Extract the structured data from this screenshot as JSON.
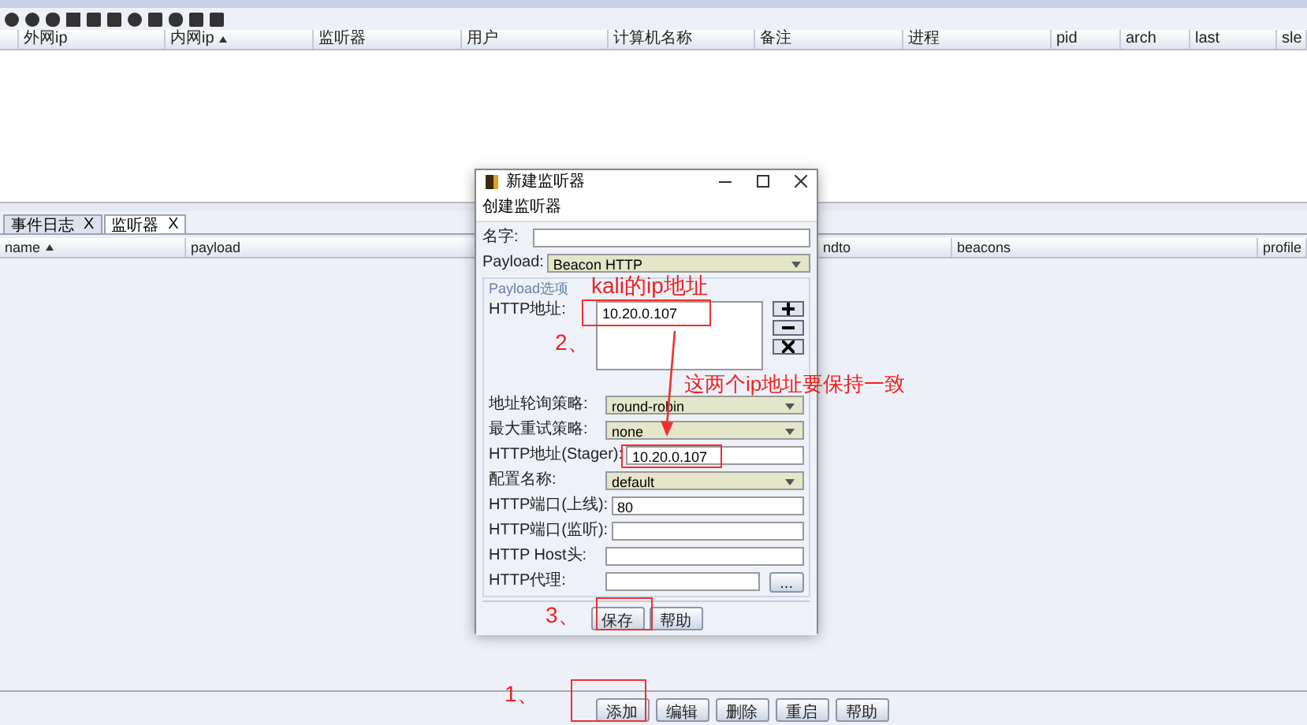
{
  "sessions_table": {
    "columns": [
      {
        "label": "外网ip"
      },
      {
        "label": "内网ip",
        "sorted": true
      },
      {
        "label": "监听器"
      },
      {
        "label": "用户"
      },
      {
        "label": "计算机名称"
      },
      {
        "label": "备注"
      },
      {
        "label": "进程"
      },
      {
        "label": "pid"
      },
      {
        "label": "arch"
      },
      {
        "label": "last"
      },
      {
        "label": "sle"
      }
    ]
  },
  "tabs": [
    {
      "label": "事件日志",
      "close": "X",
      "selected": false
    },
    {
      "label": "监听器",
      "close": "X",
      "selected": true
    }
  ],
  "listeners_table": {
    "columns": [
      {
        "label": "name",
        "sorted": true
      },
      {
        "label": "payload"
      },
      {
        "label": "ndto"
      },
      {
        "label": "beacons"
      },
      {
        "label": "profile"
      }
    ]
  },
  "buttons": [
    {
      "label": "添加"
    },
    {
      "label": "编辑"
    },
    {
      "label": "删除"
    },
    {
      "label": "重启"
    },
    {
      "label": "帮助"
    }
  ],
  "dialog": {
    "title": "新建监听器",
    "subtitle": "创建监听器",
    "name_label": "名字:",
    "payload_label": "Payload:",
    "payload_value": "Beacon HTTP",
    "section": "Payload选项",
    "hosts_label": "HTTP地址:",
    "hosts": [
      "10.20.0.107"
    ],
    "fields": [
      {
        "kind": "select",
        "label": "地址轮询策略:",
        "value": "round-robin"
      },
      {
        "kind": "select",
        "label": "最大重试策略:",
        "value": "none"
      },
      {
        "kind": "text",
        "label": "HTTP地址(Stager):",
        "value": "10.20.0.107"
      },
      {
        "kind": "select",
        "label": "配置名称:",
        "value": "default"
      },
      {
        "kind": "text",
        "label": "HTTP端口(上线):",
        "value": "80"
      },
      {
        "kind": "text",
        "label": "HTTP端口(监听):"
      },
      {
        "kind": "text",
        "label": "HTTP Host头:"
      },
      {
        "kind": "browse",
        "label": "HTTP代理:",
        "button": "..."
      }
    ],
    "buttons": [
      {
        "label": "保存"
      },
      {
        "label": "帮助"
      }
    ]
  },
  "annotations": [
    {
      "text": "kali的ip地址"
    },
    {
      "text": "2、"
    },
    {
      "text": "这两个ip地址要保持一致"
    },
    {
      "text": "3、"
    },
    {
      "text": "1、"
    }
  ]
}
